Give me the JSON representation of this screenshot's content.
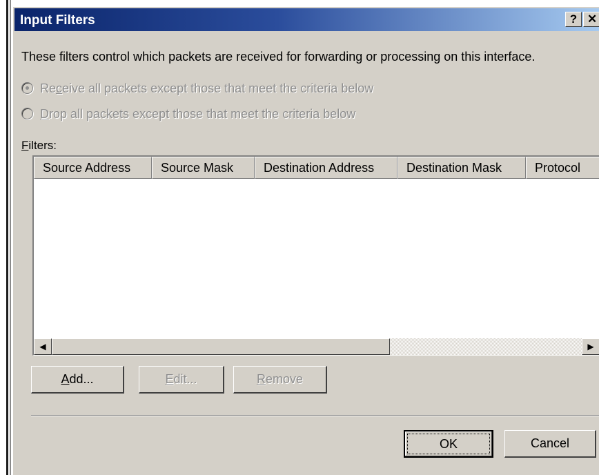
{
  "window": {
    "title": "Input Filters",
    "help_glyph": "?",
    "close_glyph": "✕"
  },
  "description": "These filters control which packets are received for forwarding or processing on this interface.",
  "options": [
    {
      "prefix": "Re",
      "mnemonic": "c",
      "suffix": "eive all packets except those that meet the criteria below",
      "selected": true,
      "enabled": false
    },
    {
      "prefix": "",
      "mnemonic": "D",
      "suffix": "rop all packets except those that meet the criteria below",
      "selected": false,
      "enabled": false
    }
  ],
  "filters_label": {
    "mnemonic": "F",
    "rest": "ilters:"
  },
  "table": {
    "columns": [
      "Source Address",
      "Source Mask",
      "Destination Address",
      "Destination Mask",
      "Protocol"
    ],
    "rows": []
  },
  "buttons": {
    "add": {
      "mnemonic": "A",
      "rest": "dd...",
      "enabled": true
    },
    "edit": {
      "mnemonic": "E",
      "rest": "dit...",
      "enabled": false
    },
    "remove": {
      "mnemonic": "R",
      "rest": "emove",
      "enabled": false
    },
    "ok": "OK",
    "cancel": "Cancel"
  },
  "scrollbar": {
    "left_glyph": "◀",
    "right_glyph": "▶"
  }
}
